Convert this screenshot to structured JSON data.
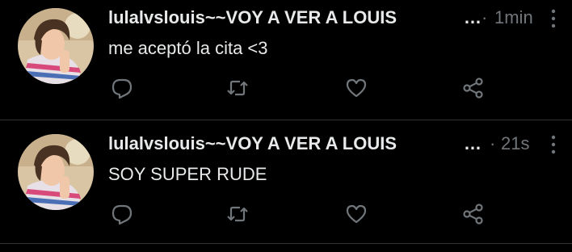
{
  "tweets": [
    {
      "display_name": "lulalvslouis~~VOY A VER A LOUIS",
      "ellipsis": "…",
      "separator": "·",
      "timestamp": "1min",
      "text": "me aceptó la cita <3",
      "avatar": "profile-photo",
      "actions": [
        "reply-icon",
        "retweet-icon",
        "like-icon",
        "share-icon"
      ],
      "more": "more-options-icon"
    },
    {
      "display_name": "lulalvslouis~~VOY A VER A LOUIS",
      "ellipsis": "…",
      "separator": "·",
      "timestamp": "21s",
      "text": "SOY SUPER RUDE",
      "avatar": "profile-photo",
      "actions": [
        "reply-icon",
        "retweet-icon",
        "like-icon",
        "share-icon"
      ],
      "more": "more-options-icon"
    }
  ],
  "colors": {
    "background": "#000000",
    "primary_text": "#e7e9ea",
    "secondary_text": "#71767b",
    "divider": "#2f3336"
  }
}
